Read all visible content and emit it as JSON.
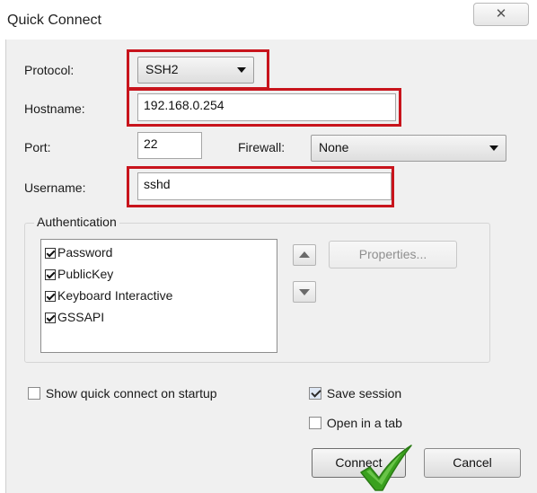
{
  "window": {
    "title": "Quick Connect",
    "close_glyph": "✕"
  },
  "form": {
    "protocol": {
      "label": "Protocol:",
      "value": "SSH2"
    },
    "hostname": {
      "label": "Hostname:",
      "value": "192.168.0.254"
    },
    "port": {
      "label": "Port:",
      "value": "22"
    },
    "firewall": {
      "label": "Firewall:",
      "value": "None"
    },
    "username": {
      "label": "Username:",
      "value": "sshd"
    }
  },
  "authentication": {
    "title": "Authentication",
    "methods": [
      {
        "label": "Password",
        "checked": true
      },
      {
        "label": "PublicKey",
        "checked": true
      },
      {
        "label": "Keyboard Interactive",
        "checked": true
      },
      {
        "label": "GSSAPI",
        "checked": true
      }
    ],
    "properties_label": "Properties..."
  },
  "options": {
    "show_on_startup": {
      "label": "Show quick connect on startup",
      "checked": false
    },
    "save_session": {
      "label": "Save session",
      "checked": true
    },
    "open_in_tab": {
      "label": "Open in a tab",
      "checked": false
    }
  },
  "buttons": {
    "connect": "Connect",
    "cancel": "Cancel"
  },
  "colors": {
    "highlight": "#c8141c",
    "checkmark": "#3aa11e"
  }
}
